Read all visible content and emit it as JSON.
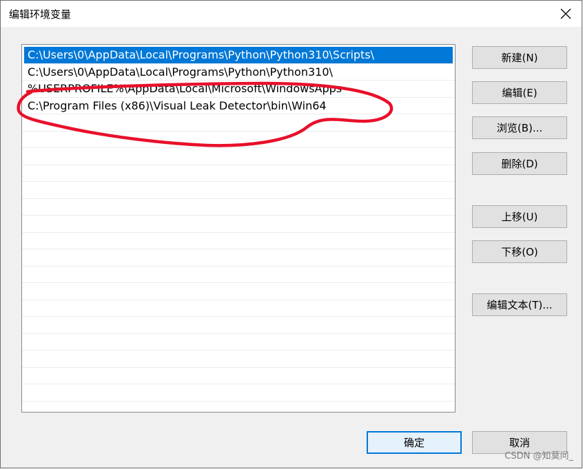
{
  "window": {
    "title": "编辑环境变量",
    "close_icon": "close-icon"
  },
  "list": {
    "items": [
      {
        "text": "C:\\Users\\0\\AppData\\Local\\Programs\\Python\\Python310\\Scripts\\",
        "selected": true
      },
      {
        "text": "C:\\Users\\0\\AppData\\Local\\Programs\\Python\\Python310\\",
        "selected": false
      },
      {
        "text": "%USERPROFILE%\\AppData\\Local\\Microsoft\\WindowsApps",
        "selected": false
      },
      {
        "text": "C:\\Program Files (x86)\\Visual Leak Detector\\bin\\Win64",
        "selected": false
      }
    ]
  },
  "buttons": {
    "new": "新建(N)",
    "edit": "编辑(E)",
    "browse": "浏览(B)...",
    "delete": "删除(D)",
    "move_up": "上移(U)",
    "move_down": "下移(O)",
    "edit_text": "编辑文本(T)...",
    "ok": "确定",
    "cancel": "取消"
  },
  "watermark": "CSDN @知莫问_",
  "colors": {
    "selection": "#0078d7",
    "annotation": "#e8102a"
  }
}
